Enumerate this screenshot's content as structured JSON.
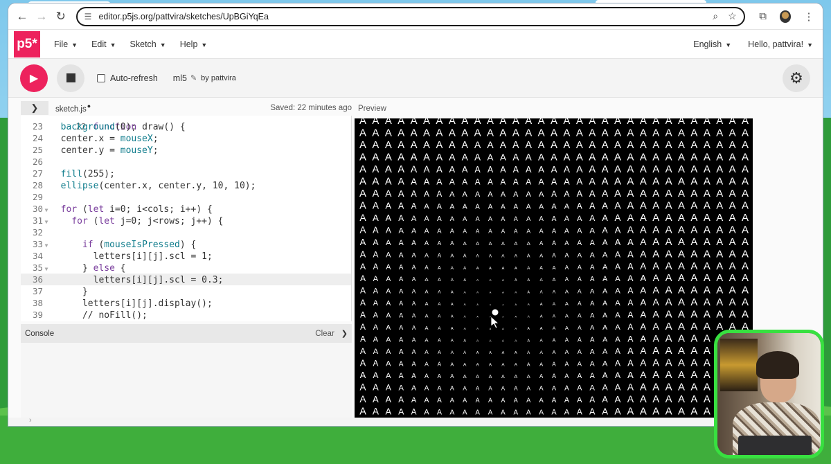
{
  "browser": {
    "url": "editor.p5js.org/pattvira/sketches/UpBGiYqEa"
  },
  "menubar": {
    "logo": "p5*",
    "items": [
      "File",
      "Edit",
      "Sketch",
      "Help"
    ],
    "language": "English",
    "greeting": "Hello, pattvira!"
  },
  "toolbar": {
    "auto_refresh_label": "Auto-refresh",
    "auto_refresh_checked": false,
    "sketch_name": "ml5",
    "author": "by pattvira"
  },
  "editor": {
    "file_name": "sketch.js",
    "saved_status": "Saved: 22 minutes ago",
    "preview_label": "Preview",
    "partial_top_line": "function draw() {",
    "lines": [
      {
        "n": "23",
        "code": "  background(0);",
        "fold": ""
      },
      {
        "n": "24",
        "code": "  center.x = mouseX;",
        "fold": ""
      },
      {
        "n": "25",
        "code": "  center.y = mouseY;",
        "fold": ""
      },
      {
        "n": "26",
        "code": "",
        "fold": ""
      },
      {
        "n": "27",
        "code": "  fill(255);",
        "fold": ""
      },
      {
        "n": "28",
        "code": "  ellipse(center.x, center.y, 10, 10);",
        "fold": ""
      },
      {
        "n": "29",
        "code": "",
        "fold": ""
      },
      {
        "n": "30",
        "code": "  for (let i=0; i<cols; i++) {",
        "fold": "▼"
      },
      {
        "n": "31",
        "code": "    for (let j=0; j<rows; j++) {",
        "fold": "▼"
      },
      {
        "n": "32",
        "code": "",
        "fold": ""
      },
      {
        "n": "33",
        "code": "      if (mouseIsPressed) {",
        "fold": "▼"
      },
      {
        "n": "34",
        "code": "        letters[i][j].scl = 1;",
        "fold": ""
      },
      {
        "n": "35",
        "code": "      } else {",
        "fold": "▼"
      },
      {
        "n": "36",
        "code": "        letters[i][j].scl = 0.3;",
        "fold": ""
      },
      {
        "n": "37",
        "code": "      }",
        "fold": ""
      },
      {
        "n": "38",
        "code": "      letters[i][j].display();",
        "fold": ""
      },
      {
        "n": "39",
        "code": "      // noFill();",
        "fold": ""
      }
    ],
    "active_line": "36"
  },
  "console": {
    "label": "Console",
    "clear_label": "Clear"
  },
  "canvas": {
    "glyph": "A",
    "background": "#000000",
    "foreground": "#ffffff"
  },
  "colors": {
    "p5_pink": "#ed225d",
    "webcam_border": "#38e040"
  },
  "icons": [
    "back-arrow-icon",
    "forward-arrow-icon",
    "reload-icon",
    "site-settings-icon",
    "zoom-icon",
    "star-icon",
    "extensions-icon",
    "more-vert-icon",
    "play-icon",
    "stop-icon",
    "pencil-icon",
    "gear-icon",
    "chevron-right-icon",
    "chevron-down-icon"
  ]
}
